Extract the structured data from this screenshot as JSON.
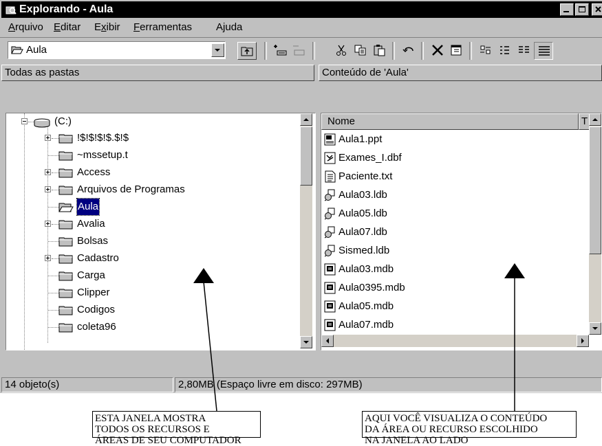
{
  "window": {
    "title": "Explorando - Aula"
  },
  "menu": [
    {
      "label": "Arquivo",
      "accel": "A"
    },
    {
      "label": "Editar",
      "accel": "E"
    },
    {
      "label": "Exibir",
      "accel": "x"
    },
    {
      "label": "Ferramentas",
      "accel": "F"
    },
    {
      "label": "Ajuda",
      "accel": "j"
    }
  ],
  "toolbar": {
    "address_value": "Aula"
  },
  "left_pane": {
    "header": "Todas as pastas",
    "drive": "(C:)",
    "folders": [
      {
        "name": "!$!$!$!$.$!$",
        "expandable": true,
        "selected": false
      },
      {
        "name": "~mssetup.t",
        "expandable": false,
        "selected": false
      },
      {
        "name": "Access",
        "expandable": true,
        "selected": false
      },
      {
        "name": "Arquivos de Programas",
        "expandable": true,
        "selected": false
      },
      {
        "name": "Aula",
        "expandable": false,
        "selected": true
      },
      {
        "name": "Avalia",
        "expandable": true,
        "selected": false
      },
      {
        "name": "Bolsas",
        "expandable": false,
        "selected": false
      },
      {
        "name": "Cadastro",
        "expandable": true,
        "selected": false
      },
      {
        "name": "Carga",
        "expandable": false,
        "selected": false
      },
      {
        "name": "Clipper",
        "expandable": false,
        "selected": false
      },
      {
        "name": "Codigos",
        "expandable": false,
        "selected": false
      },
      {
        "name": "coleta96",
        "expandable": false,
        "selected": false
      }
    ]
  },
  "right_pane": {
    "header": "Conteúdo de 'Aula'",
    "column_name": "Nome",
    "column_type_partial": "T",
    "files": [
      {
        "name": "Aula1.ppt",
        "icon": "powerpoint-file-icon"
      },
      {
        "name": "Exames_I.dbf",
        "icon": "dbf-file-icon"
      },
      {
        "name": "Paciente.txt",
        "icon": "text-file-icon"
      },
      {
        "name": "Aula03.ldb",
        "icon": "ldb-file-icon"
      },
      {
        "name": "Aula05.ldb",
        "icon": "ldb-file-icon"
      },
      {
        "name": "Aula07.ldb",
        "icon": "ldb-file-icon"
      },
      {
        "name": "Sismed.ldb",
        "icon": "ldb-file-icon"
      },
      {
        "name": "Aula03.mdb",
        "icon": "mdb-file-icon"
      },
      {
        "name": "Aula0395.mdb",
        "icon": "mdb-file-icon"
      },
      {
        "name": "Aula05.mdb",
        "icon": "mdb-file-icon"
      },
      {
        "name": "Aula07.mdb",
        "icon": "mdb-file-icon"
      }
    ]
  },
  "status": {
    "objects": "14 objeto(s)",
    "space": "2,80MB (Espaço livre em disco: 297MB)"
  },
  "annotations": {
    "left": "ESTA JANELA MOSTRA\nTODOS OS RECURSOS E\nÁREAS DE SEU COMPUTADOR",
    "right": "AQUI VOCÊ VISUALIZA O CONTEÚDO\nDA ÁREA OU RECURSO ESCOLHIDO\nNA JANELA AO LADO"
  }
}
